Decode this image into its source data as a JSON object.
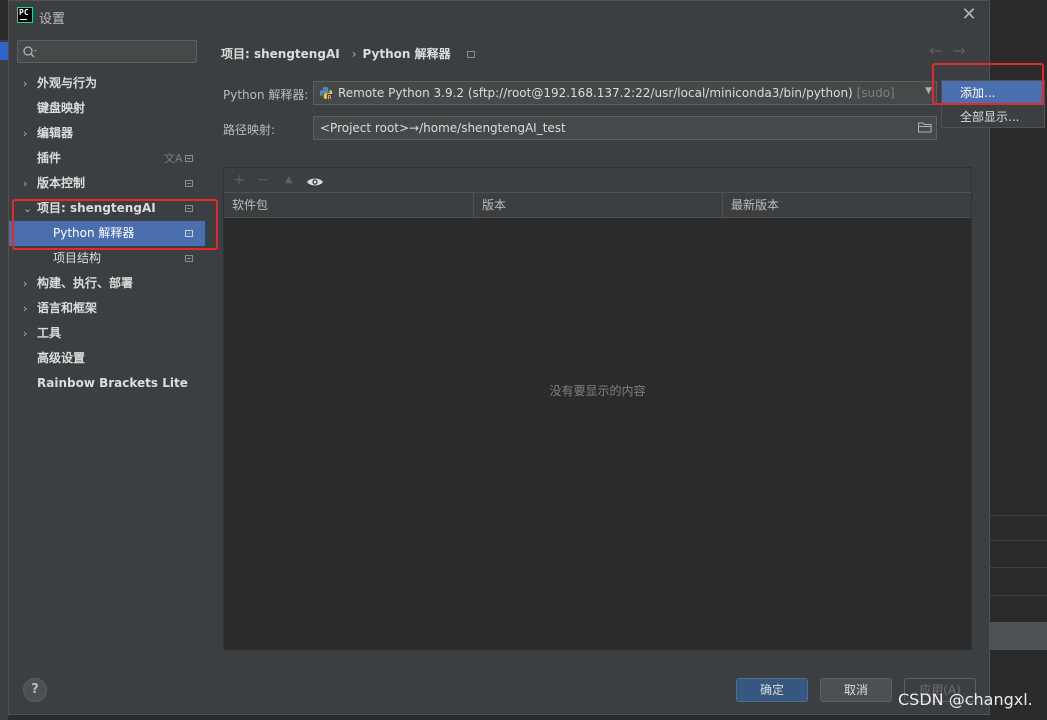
{
  "window": {
    "title": "设置",
    "app_logo_text": "PC"
  },
  "search": {
    "placeholder": ""
  },
  "sidebar": {
    "items": [
      {
        "label": "外观与行为",
        "expandable": true
      },
      {
        "label": "键盘映射",
        "expandable": false
      },
      {
        "label": "编辑器",
        "expandable": true
      },
      {
        "label": "插件",
        "expandable": false
      },
      {
        "label": "版本控制",
        "expandable": true
      },
      {
        "label": "项目: shengtengAI",
        "expandable": true,
        "expanded": true
      },
      {
        "label": "Python 解释器",
        "child": true,
        "selected": true
      },
      {
        "label": "项目结构",
        "child": true
      },
      {
        "label": "构建、执行、部署",
        "expandable": true
      },
      {
        "label": "语言和框架",
        "expandable": true
      },
      {
        "label": "工具",
        "expandable": true
      },
      {
        "label": "高级设置",
        "expandable": false
      },
      {
        "label": "Rainbow Brackets Lite",
        "expandable": false
      }
    ]
  },
  "breadcrumb": {
    "parent": "项目: shengtengAI",
    "separator": "›",
    "current": "Python 解释器"
  },
  "interpreter": {
    "label": "Python 解释器:",
    "value": "Remote Python 3.9.2 (sftp://root@192.168.137.2:22/usr/local/miniconda3/bin/python)",
    "suffix": "[sudo]"
  },
  "path_mapping": {
    "label": "路径映射:",
    "value": "<Project root>→/home/shengtengAI_test"
  },
  "packages": {
    "columns": [
      "软件包",
      "版本",
      "最新版本"
    ],
    "empty_text": "没有要显示的内容"
  },
  "popup_menu": {
    "items": [
      "添加...",
      "全部显示..."
    ]
  },
  "footer": {
    "ok": "确定",
    "cancel": "取消",
    "apply": "应用(A)",
    "help": "?"
  },
  "watermark": "CSDN @changxl.",
  "colors": {
    "accent": "#4b6eaf",
    "highlight_box": "#e5282a",
    "primary_button": "#365880"
  }
}
